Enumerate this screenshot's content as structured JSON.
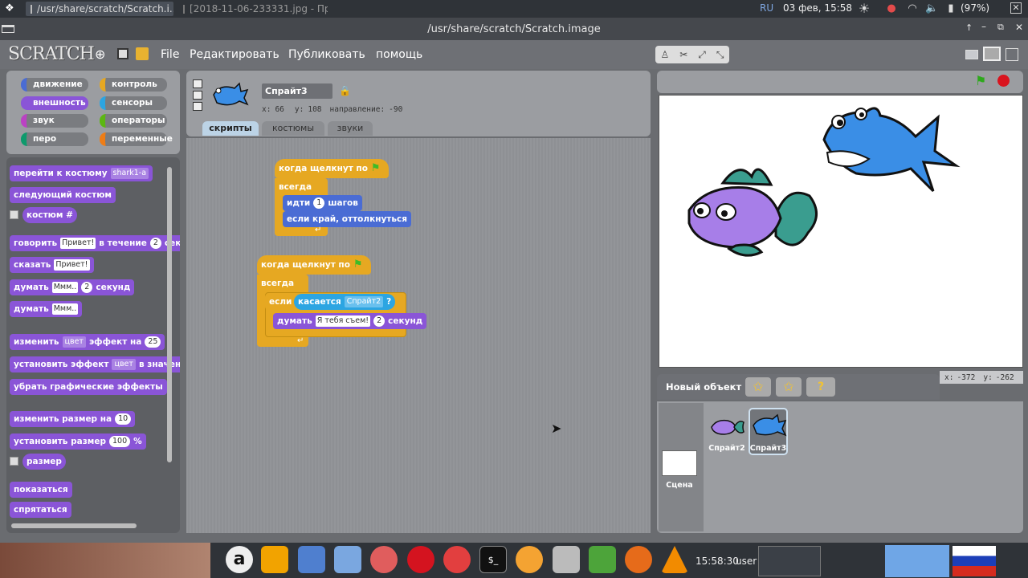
{
  "system_bar": {
    "tasks": [
      "/usr/share/scratch/Scratch.i...",
      "[2018-11-06-233331.jpg - Пр..."
    ],
    "lang": "RU",
    "datetime": "03 фев, 15:58",
    "battery": "(97%)"
  },
  "window": {
    "title": "/usr/share/scratch/Scratch.image"
  },
  "menu": {
    "logo": "SCRATCH",
    "file": "File",
    "edit": "Редактировать",
    "publish": "Публиковать",
    "help": "помощь"
  },
  "categories": [
    {
      "label": "движение",
      "color": "#4a6cd4"
    },
    {
      "label": "контроль",
      "color": "#e6a822"
    },
    {
      "label": "внешность",
      "color": "#8a55d7"
    },
    {
      "label": "сенсоры",
      "color": "#2ca5e2"
    },
    {
      "label": "звук",
      "color": "#bb42c3"
    },
    {
      "label": "операторы",
      "color": "#5cb712"
    },
    {
      "label": "перо",
      "color": "#0e9a6c"
    },
    {
      "label": "переменные",
      "color": "#ee7d16"
    }
  ],
  "palette": {
    "switch_costume": "перейти к костюму",
    "costume_value": "shark1-a",
    "next_costume": "следующий костюм",
    "costume_num": "костюм #",
    "say_for": "говорить",
    "say_for_text": "Привет!",
    "say_for_mid": "в течение",
    "say_for_secs": "2",
    "say_for_end": "секунд",
    "say": "сказать",
    "say_text": "Привет!",
    "think_for": "думать",
    "think_for_text": "Ммм..",
    "think_for_secs": "2",
    "think_for_end": "секунд",
    "think": "думать",
    "think_text": "Ммм..",
    "change_effect": "изменить",
    "change_effect_dd": "цвет",
    "change_effect_mid": "эффект на",
    "change_effect_val": "25",
    "set_effect": "установить эффект",
    "set_effect_dd": "цвет",
    "set_effect_end": "в значение",
    "clear_effects": "убрать графические эффекты",
    "change_size": "изменить размер на",
    "change_size_val": "10",
    "set_size": "установить размер",
    "set_size_val": "100",
    "set_size_pct": "%",
    "size": "размер",
    "show": "показаться",
    "hide": "спрятаться"
  },
  "sprite_info": {
    "name": "Спрайт3",
    "x_label": "x:",
    "x": "66",
    "y_label": "y:",
    "y": "108",
    "dir_label": "направление:",
    "direction": "-90"
  },
  "tabs": [
    "скрипты",
    "костюмы",
    "звуки"
  ],
  "scripts": {
    "s1_hat": "когда щелкнут по",
    "s1_forever": "всегда",
    "s1_move": "идти",
    "s1_move_val": "1",
    "s1_move_end": "шагов",
    "s1_bounce": "если край, оттолкнуться",
    "s2_hat": "когда щелкнут по",
    "s2_forever": "всегда",
    "s2_if": "если",
    "s2_touching": "касается",
    "s2_touching_dd": "Спрайт2",
    "s2_q": "?",
    "s2_think": "думать",
    "s2_think_text": "Я тебя съем!",
    "s2_think_secs": "2",
    "s2_think_end": "секунд"
  },
  "stage": {
    "mouse_x_label": "x:",
    "mouse_x": "-372",
    "mouse_y_label": "y:",
    "mouse_y": "-262"
  },
  "sprites_panel": {
    "new_sprite": "Новый объект",
    "sprites": [
      "Спрайт2",
      "Спрайт3"
    ],
    "stage_label": "Сцена"
  },
  "taskbar": {
    "time": "15:58:30",
    "user": "user"
  }
}
